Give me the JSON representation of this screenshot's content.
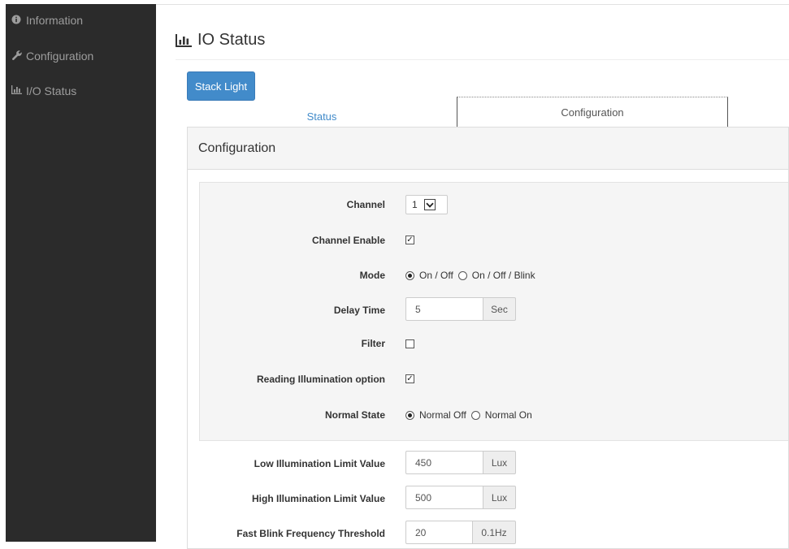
{
  "sidebar": {
    "items": [
      {
        "label": "Information",
        "icon": "info-circle-icon"
      },
      {
        "label": "Configuration",
        "icon": "wrench-icon"
      },
      {
        "label": "I/O Status",
        "icon": "bar-chart-icon"
      }
    ]
  },
  "header": {
    "title": "IO Status",
    "icon": "bar-chart-icon"
  },
  "stack_light_button": "Stack Light",
  "tabs": [
    {
      "label": "Status"
    },
    {
      "label": "Configuration"
    }
  ],
  "panel": {
    "heading": "Configuration",
    "fields": {
      "channel": {
        "label": "Channel",
        "value": "1"
      },
      "channel_enable": {
        "label": "Channel Enable",
        "checked": true
      },
      "mode": {
        "label": "Mode",
        "options": [
          "On / Off",
          "On / Off / Blink"
        ],
        "selected": "On / Off"
      },
      "delay_time": {
        "label": "Delay Time",
        "value": "5",
        "unit": "Sec"
      },
      "filter": {
        "label": "Filter",
        "checked": false
      },
      "reading_illumination": {
        "label": "Reading Illumination option",
        "checked": true
      },
      "normal_state": {
        "label": "Normal State",
        "options": [
          "Normal Off",
          "Normal On"
        ],
        "selected": "Normal Off"
      },
      "low_illumination": {
        "label": "Low Illumination Limit Value",
        "value": "450",
        "unit": "Lux"
      },
      "high_illumination": {
        "label": "High Illumination Limit Value",
        "value": "500",
        "unit": "Lux"
      },
      "fast_blink": {
        "label": "Fast Blink Frequency Threshold",
        "value": "20",
        "unit": "0.1Hz"
      }
    }
  },
  "colors": {
    "sidebar_bg": "#2b2b2b",
    "primary": "#428bca",
    "panel_heading_bg": "#f5f5f5"
  }
}
